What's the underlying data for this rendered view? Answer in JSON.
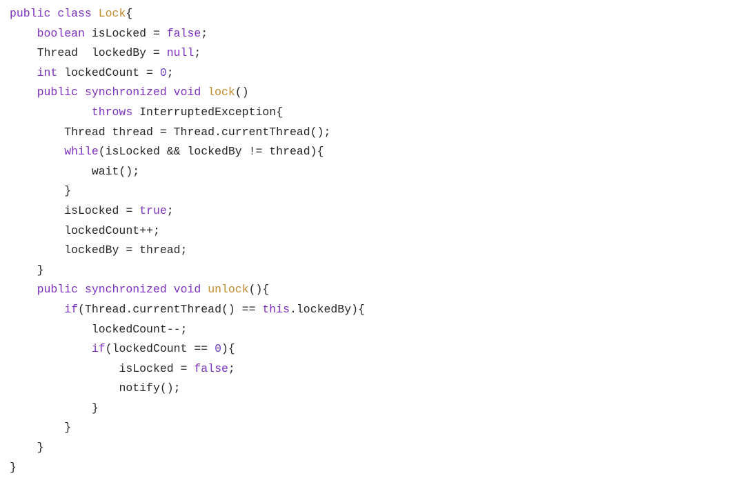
{
  "language": "java",
  "tokens": [
    [
      [
        "kw",
        "public"
      ],
      [
        "sp",
        " "
      ],
      [
        "kw",
        "class"
      ],
      [
        "sp",
        " "
      ],
      [
        "type",
        "Lock"
      ],
      [
        "txt",
        "{"
      ]
    ],
    [
      [
        "pad",
        "    "
      ],
      [
        "kw",
        "boolean"
      ],
      [
        "sp",
        " "
      ],
      [
        "txt",
        "isLocked = "
      ],
      [
        "bool",
        "false"
      ],
      [
        "txt",
        ";"
      ]
    ],
    [
      [
        "pad",
        "    "
      ],
      [
        "txt",
        "Thread  lockedBy = "
      ],
      [
        "bool",
        "null"
      ],
      [
        "txt",
        ";"
      ]
    ],
    [
      [
        "pad",
        "    "
      ],
      [
        "kw",
        "int"
      ],
      [
        "sp",
        " "
      ],
      [
        "txt",
        "lockedCount = "
      ],
      [
        "num",
        "0"
      ],
      [
        "txt",
        ";"
      ]
    ],
    [
      [
        "pad",
        "    "
      ],
      [
        "kw",
        "public"
      ],
      [
        "sp",
        " "
      ],
      [
        "kw",
        "synchronized"
      ],
      [
        "sp",
        " "
      ],
      [
        "kw",
        "void"
      ],
      [
        "sp",
        " "
      ],
      [
        "type",
        "lock"
      ],
      [
        "txt",
        "()"
      ]
    ],
    [
      [
        "pad",
        "            "
      ],
      [
        "kw",
        "throws"
      ],
      [
        "sp",
        " "
      ],
      [
        "txt",
        "InterruptedException{"
      ]
    ],
    [
      [
        "pad",
        "        "
      ],
      [
        "txt",
        "Thread thread = Thread.currentThread();"
      ]
    ],
    [
      [
        "pad",
        "        "
      ],
      [
        "kw",
        "while"
      ],
      [
        "txt",
        "(isLocked && lockedBy != thread){"
      ]
    ],
    [
      [
        "pad",
        "            "
      ],
      [
        "txt",
        "wait();"
      ]
    ],
    [
      [
        "pad",
        "        "
      ],
      [
        "txt",
        "}"
      ]
    ],
    [
      [
        "pad",
        "        "
      ],
      [
        "txt",
        "isLocked = "
      ],
      [
        "bool",
        "true"
      ],
      [
        "txt",
        ";"
      ]
    ],
    [
      [
        "pad",
        "        "
      ],
      [
        "txt",
        "lockedCount++;"
      ]
    ],
    [
      [
        "pad",
        "        "
      ],
      [
        "txt",
        "lockedBy = thread;"
      ]
    ],
    [
      [
        "pad",
        "    "
      ],
      [
        "txt",
        "}"
      ]
    ],
    [
      [
        "pad",
        "    "
      ],
      [
        "kw",
        "public"
      ],
      [
        "sp",
        " "
      ],
      [
        "kw",
        "synchronized"
      ],
      [
        "sp",
        " "
      ],
      [
        "kw",
        "void"
      ],
      [
        "sp",
        " "
      ],
      [
        "type",
        "unlock"
      ],
      [
        "txt",
        "(){"
      ]
    ],
    [
      [
        "pad",
        "        "
      ],
      [
        "kw",
        "if"
      ],
      [
        "txt",
        "(Thread.currentThread() == "
      ],
      [
        "kw",
        "this"
      ],
      [
        "txt",
        ".lockedBy){"
      ]
    ],
    [
      [
        "pad",
        "            "
      ],
      [
        "txt",
        "lockedCount--;"
      ]
    ],
    [
      [
        "pad",
        "            "
      ],
      [
        "kw",
        "if"
      ],
      [
        "txt",
        "(lockedCount == "
      ],
      [
        "num",
        "0"
      ],
      [
        "txt",
        "){"
      ]
    ],
    [
      [
        "pad",
        "                "
      ],
      [
        "txt",
        "isLocked = "
      ],
      [
        "bool",
        "false"
      ],
      [
        "txt",
        ";"
      ]
    ],
    [
      [
        "pad",
        "                "
      ],
      [
        "txt",
        "notify();"
      ]
    ],
    [
      [
        "pad",
        "            "
      ],
      [
        "txt",
        "}"
      ]
    ],
    [
      [
        "pad",
        "        "
      ],
      [
        "txt",
        "}"
      ]
    ],
    [
      [
        "pad",
        "    "
      ],
      [
        "txt",
        "}"
      ]
    ],
    [
      [
        "txt",
        "}"
      ]
    ]
  ]
}
